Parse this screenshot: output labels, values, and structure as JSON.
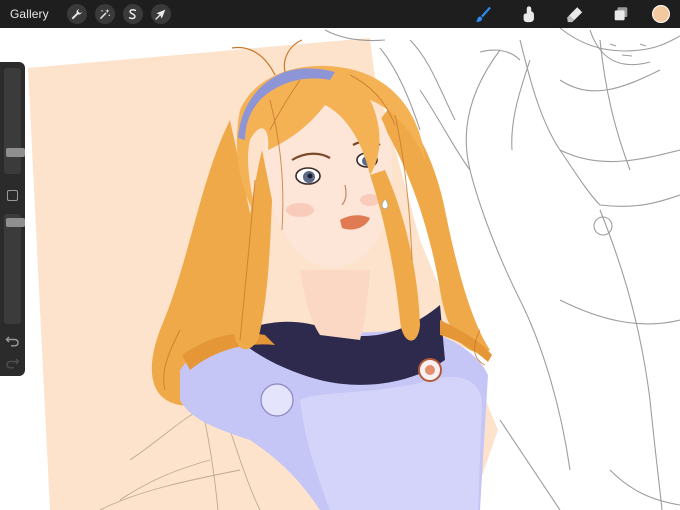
{
  "app": {
    "gallery_label": "Gallery",
    "active_color": "#f5c9a0",
    "accent_color": "#2f8cf2"
  },
  "toolbar": {
    "left_tools": [
      "wrench-icon",
      "magic-wand-icon",
      "selection-icon",
      "transform-arrow-icon"
    ],
    "right_tools": [
      "brush-icon",
      "smudge-icon",
      "eraser-icon",
      "layers-icon"
    ],
    "active_tool": "brush-icon"
  },
  "sidebar": {
    "brush_size_level": 0.18,
    "opacity_level": 0.96
  }
}
